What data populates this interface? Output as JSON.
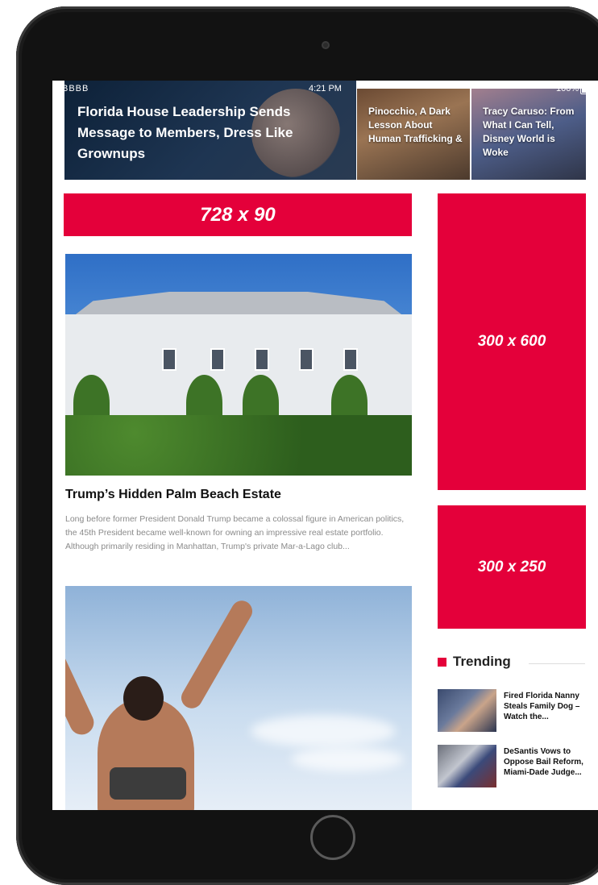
{
  "status_bar": {
    "carrier": "BBBB",
    "time": "4:21 PM",
    "battery": "100%"
  },
  "hero": {
    "title": "Florida House Leadership Sends Message to Members, Dress Like Grownups"
  },
  "thumbs": [
    {
      "title": "Pinocchio, A Dark Lesson About Human Trafficking &"
    },
    {
      "title": "Tracy Caruso: From What I Can Tell, Disney World is Woke"
    }
  ],
  "ads": {
    "leaderboard": "728 x 90",
    "skyscraper": "300 x 600",
    "rectangle": "300 x 250"
  },
  "article": {
    "title": "Trump’s Hidden Palm Beach Estate",
    "excerpt": "Long before former President Donald Trump became a colossal figure in American politics, the 45th President became well-known for owning an impressive real estate portfolio. Although primarily residing in Manhattan, Trump's private Mar-a-Lago club..."
  },
  "trending": {
    "label": "Trending",
    "items": [
      {
        "title": "Fired Florida Nanny Steals Family Dog – Watch the..."
      },
      {
        "title": "DeSantis Vows to Oppose Bail Reform, Miami-Dade Judge..."
      }
    ]
  },
  "colors": {
    "accent": "#e4003a",
    "device": "#121212"
  }
}
